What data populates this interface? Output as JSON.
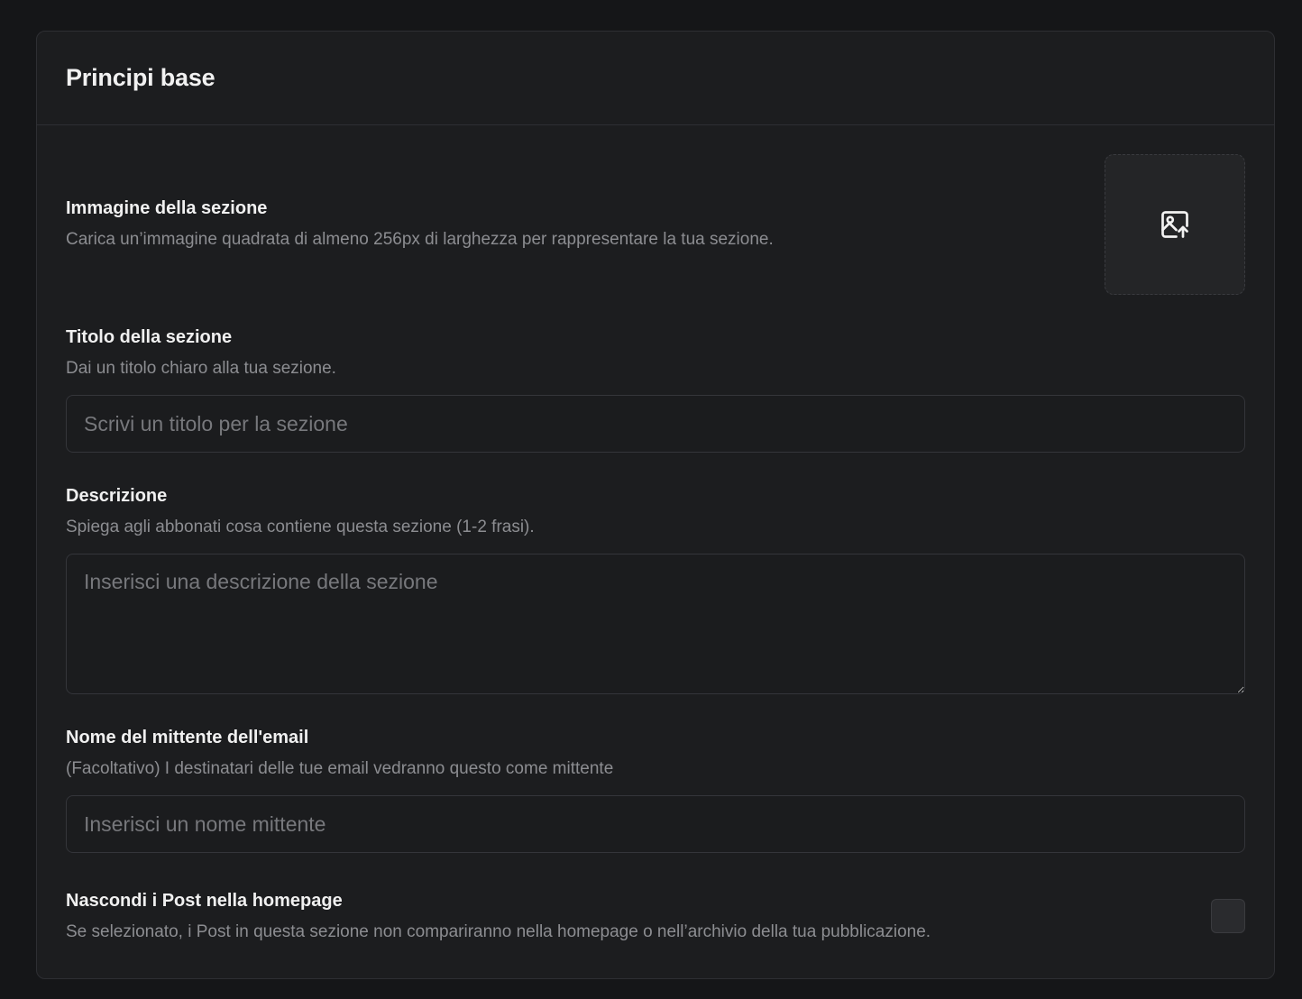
{
  "card": {
    "title": "Principi base"
  },
  "section_image": {
    "label": "Immagine della sezione",
    "help": "Carica un’immagine quadrata di almeno 256px di larghezza per rappresentare la tua sezione.",
    "icon": "image-upload-icon"
  },
  "section_title": {
    "label": "Titolo della sezione",
    "help": "Dai un titolo chiaro alla tua sezione.",
    "value": "",
    "placeholder": "Scrivi un titolo per la sezione"
  },
  "description": {
    "label": "Descrizione",
    "help": "Spiega agli abbonati cosa contiene questa sezione (1-2 frasi).",
    "value": "",
    "placeholder": "Inserisci una descrizione della sezione"
  },
  "sender_name": {
    "label": "Nome del mittente dell'email",
    "help": "(Facoltativo) I destinatari delle tue email vedranno questo come mittente",
    "value": "",
    "placeholder": "Inserisci un nome mittente"
  },
  "hide_posts": {
    "label": "Nascondi i Post nella homepage",
    "help": "Se selezionato, i Post in questa sezione non compariranno nella homepage o nell’archivio della tua pubblicazione.",
    "checked": false
  }
}
